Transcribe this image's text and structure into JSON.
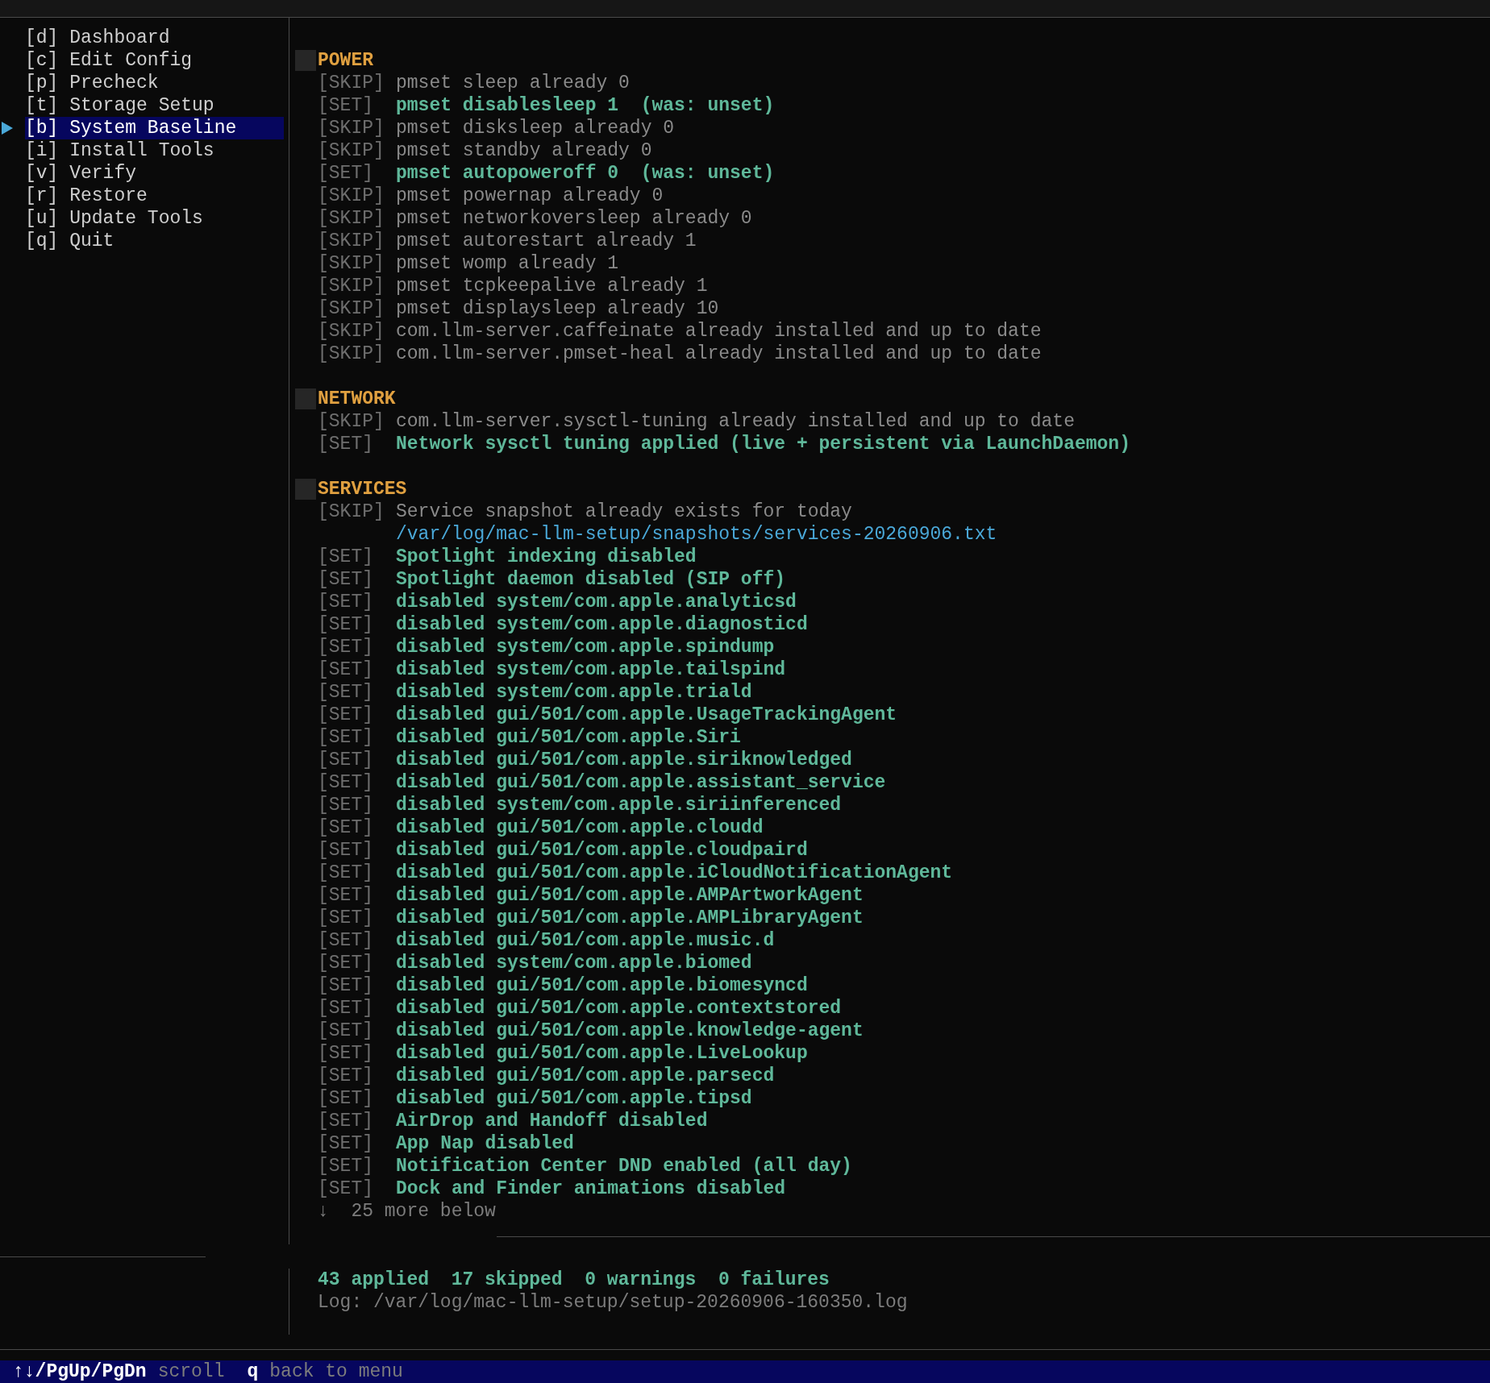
{
  "menu": [
    {
      "label": "[d] Dashboard",
      "selected": false
    },
    {
      "label": "[c] Edit Config",
      "selected": false
    },
    {
      "label": "[p] Precheck",
      "selected": false
    },
    {
      "label": "[t] Storage Setup",
      "selected": false
    },
    {
      "label": "[b] System Baseline",
      "selected": true
    },
    {
      "label": "[i] Install Tools",
      "selected": false
    },
    {
      "label": "[v] Verify",
      "selected": false
    },
    {
      "label": "[r] Restore",
      "selected": false
    },
    {
      "label": "[u] Update Tools",
      "selected": false
    },
    {
      "label": "[q] Quit",
      "selected": false
    }
  ],
  "sections": [
    {
      "title": "POWER",
      "lines": [
        {
          "kind": "skip",
          "tag": "[SKIP]",
          "text": "pmset sleep already 0"
        },
        {
          "kind": "set",
          "tag": "[SET]",
          "text": "pmset disablesleep 1  (was: unset)"
        },
        {
          "kind": "skip",
          "tag": "[SKIP]",
          "text": "pmset disksleep already 0"
        },
        {
          "kind": "skip",
          "tag": "[SKIP]",
          "text": "pmset standby already 0"
        },
        {
          "kind": "set",
          "tag": "[SET]",
          "text": "pmset autopoweroff 0  (was: unset)"
        },
        {
          "kind": "skip",
          "tag": "[SKIP]",
          "text": "pmset powernap already 0"
        },
        {
          "kind": "skip",
          "tag": "[SKIP]",
          "text": "pmset networkoversleep already 0"
        },
        {
          "kind": "skip",
          "tag": "[SKIP]",
          "text": "pmset autorestart already 1"
        },
        {
          "kind": "skip",
          "tag": "[SKIP]",
          "text": "pmset womp already 1"
        },
        {
          "kind": "skip",
          "tag": "[SKIP]",
          "text": "pmset tcpkeepalive already 1"
        },
        {
          "kind": "skip",
          "tag": "[SKIP]",
          "text": "pmset displaysleep already 10"
        },
        {
          "kind": "skip",
          "tag": "[SKIP]",
          "text": "com.llm-server.caffeinate already installed and up to date"
        },
        {
          "kind": "skip",
          "tag": "[SKIP]",
          "text": "com.llm-server.pmset-heal already installed and up to date"
        }
      ]
    },
    {
      "title": "NETWORK",
      "lines": [
        {
          "kind": "skip",
          "tag": "[SKIP]",
          "text": "com.llm-server.sysctl-tuning already installed and up to date"
        },
        {
          "kind": "set",
          "tag": "[SET]",
          "text": "Network sysctl tuning applied (live + persistent via LaunchDaemon)"
        }
      ]
    },
    {
      "title": "SERVICES",
      "lines": [
        {
          "kind": "skip",
          "tag": "[SKIP]",
          "text": "Service snapshot already exists for today"
        },
        {
          "kind": "path",
          "text": "/var/log/mac-llm-setup/snapshots/services-20260906.txt"
        },
        {
          "kind": "set",
          "tag": "[SET]",
          "text": "Spotlight indexing disabled"
        },
        {
          "kind": "set",
          "tag": "[SET]",
          "text": "Spotlight daemon disabled (SIP off)"
        },
        {
          "kind": "set",
          "tag": "[SET]",
          "text": "disabled system/com.apple.analyticsd"
        },
        {
          "kind": "set",
          "tag": "[SET]",
          "text": "disabled system/com.apple.diagnosticd"
        },
        {
          "kind": "set",
          "tag": "[SET]",
          "text": "disabled system/com.apple.spindump"
        },
        {
          "kind": "set",
          "tag": "[SET]",
          "text": "disabled system/com.apple.tailspind"
        },
        {
          "kind": "set",
          "tag": "[SET]",
          "text": "disabled system/com.apple.triald"
        },
        {
          "kind": "set",
          "tag": "[SET]",
          "text": "disabled gui/501/com.apple.UsageTrackingAgent"
        },
        {
          "kind": "set",
          "tag": "[SET]",
          "text": "disabled gui/501/com.apple.Siri"
        },
        {
          "kind": "set",
          "tag": "[SET]",
          "text": "disabled gui/501/com.apple.siriknowledged"
        },
        {
          "kind": "set",
          "tag": "[SET]",
          "text": "disabled gui/501/com.apple.assistant_service"
        },
        {
          "kind": "set",
          "tag": "[SET]",
          "text": "disabled system/com.apple.siriinferenced"
        },
        {
          "kind": "set",
          "tag": "[SET]",
          "text": "disabled gui/501/com.apple.cloudd"
        },
        {
          "kind": "set",
          "tag": "[SET]",
          "text": "disabled gui/501/com.apple.cloudpaird"
        },
        {
          "kind": "set",
          "tag": "[SET]",
          "text": "disabled gui/501/com.apple.iCloudNotificationAgent"
        },
        {
          "kind": "set",
          "tag": "[SET]",
          "text": "disabled gui/501/com.apple.AMPArtworkAgent"
        },
        {
          "kind": "set",
          "tag": "[SET]",
          "text": "disabled gui/501/com.apple.AMPLibraryAgent"
        },
        {
          "kind": "set",
          "tag": "[SET]",
          "text": "disabled gui/501/com.apple.music.d"
        },
        {
          "kind": "set",
          "tag": "[SET]",
          "text": "disabled system/com.apple.biomed"
        },
        {
          "kind": "set",
          "tag": "[SET]",
          "text": "disabled gui/501/com.apple.biomesyncd"
        },
        {
          "kind": "set",
          "tag": "[SET]",
          "text": "disabled gui/501/com.apple.contextstored"
        },
        {
          "kind": "set",
          "tag": "[SET]",
          "text": "disabled gui/501/com.apple.knowledge-agent"
        },
        {
          "kind": "set",
          "tag": "[SET]",
          "text": "disabled gui/501/com.apple.LiveLookup"
        },
        {
          "kind": "set",
          "tag": "[SET]",
          "text": "disabled gui/501/com.apple.parsecd"
        },
        {
          "kind": "set",
          "tag": "[SET]",
          "text": "disabled gui/501/com.apple.tipsd"
        },
        {
          "kind": "set",
          "tag": "[SET]",
          "text": "AirDrop and Handoff disabled"
        },
        {
          "kind": "set",
          "tag": "[SET]",
          "text": "App Nap disabled"
        },
        {
          "kind": "set",
          "tag": "[SET]",
          "text": "Notification Center DND enabled (all day)"
        },
        {
          "kind": "set",
          "tag": "[SET]",
          "text": "Dock and Finder animations disabled"
        }
      ]
    }
  ],
  "more": "↓  25 more below",
  "summary": "43 applied  17 skipped  0 warnings  0 failures",
  "log": "Log: /var/log/mac-llm-setup/setup-20260906-160350.log",
  "status_bar": [
    {
      "key": "↑↓/PgUp/PgDn",
      "label": "scroll"
    },
    {
      "key": "q",
      "label": "back to menu"
    }
  ]
}
